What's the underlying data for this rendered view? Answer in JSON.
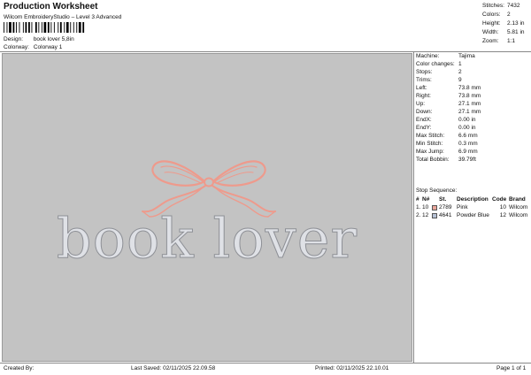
{
  "header": {
    "title": "Production Worksheet",
    "subtitle": "Wilcom EmbroideryStudio – Level 3 Advanced"
  },
  "design_info": {
    "design_label": "Design:",
    "design_value": "book lover 5,8in",
    "colorway_label": "Colorway:",
    "colorway_value": "Colorway 1"
  },
  "stats": [
    {
      "label": "Stitches:",
      "value": "7432"
    },
    {
      "label": "Colors:",
      "value": "2"
    },
    {
      "label": "Height:",
      "value": "2.13 in"
    },
    {
      "label": "Width:",
      "value": "5.81 in"
    },
    {
      "label": "Zoom:",
      "value": "1:1"
    }
  ],
  "machine_info": [
    {
      "label": "Machine:",
      "value": "Tajima"
    },
    {
      "label": "Color changes:",
      "value": "1"
    },
    {
      "label": "Stops:",
      "value": "2"
    },
    {
      "label": "Trims:",
      "value": "9"
    },
    {
      "label": "Left:",
      "value": "73.8 mm"
    },
    {
      "label": "Right:",
      "value": "73.8 mm"
    },
    {
      "label": "Up:",
      "value": "27.1 mm"
    },
    {
      "label": "Down:",
      "value": "27.1 mm"
    },
    {
      "label": "EndX:",
      "value": "0.00 in"
    },
    {
      "label": "EndY:",
      "value": "0.00 in"
    },
    {
      "label": "Max Stitch:",
      "value": "6.6 mm"
    },
    {
      "label": "Min Stitch:",
      "value": "0.3 mm"
    },
    {
      "label": "Max Jump:",
      "value": "6.9 mm"
    },
    {
      "label": "Total Bobbin:",
      "value": "39.79ft"
    }
  ],
  "stop_sequence": {
    "title": "Stop Sequence:",
    "headers": {
      "seq": "#",
      "n": "N#",
      "st": "St.",
      "desc": "Description",
      "code": "Code",
      "brand": "Brand"
    },
    "rows": [
      {
        "seq": "1.",
        "n": "10",
        "st": "2789",
        "desc": "Pink",
        "code": "10",
        "brand": "Wilcom",
        "color": "#e9a59a"
      },
      {
        "seq": "2.",
        "n": "12",
        "st": "4641",
        "desc": "Powder Blue",
        "code": "12",
        "brand": "Wilcom",
        "color": "#b7c2d6"
      }
    ]
  },
  "design": {
    "text": "book lover",
    "text_color": "#dfe1e6",
    "bow_color": "#ee9a8c",
    "background": "#c3c3c3"
  },
  "footer": {
    "created_by": "Created By:",
    "last_saved": "Last Saved: 02/11/2025 22.09.58",
    "printed": "Printed: 02/11/2025 22.10.01",
    "page": "Page 1 of 1"
  }
}
